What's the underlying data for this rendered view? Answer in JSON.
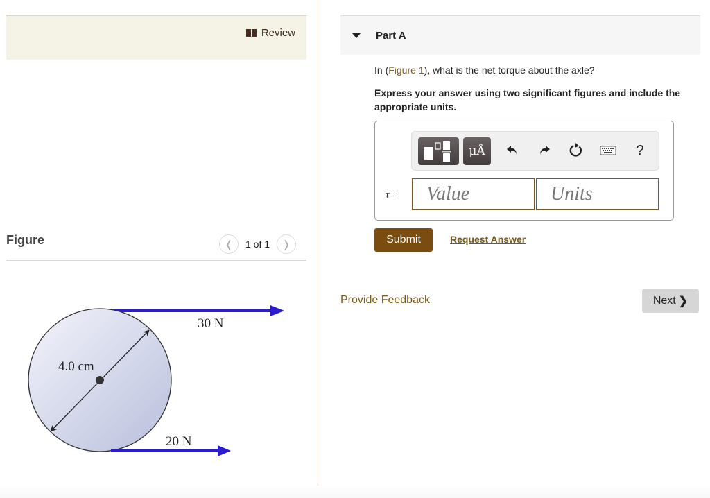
{
  "review": {
    "label": "Review",
    "icon": "book-icon"
  },
  "figure_panel": {
    "title": "Figure",
    "pager_text": "1 of 1",
    "prev_icon": "chevron-left-icon",
    "next_icon": "chevron-right-icon",
    "diagram": {
      "diameter_label": "4.0 cm",
      "top_force_label": "30 N",
      "bottom_force_label": "20 N",
      "force_color": "#2b1ccf"
    }
  },
  "part": {
    "title": "Part A",
    "question_prefix": "In (",
    "question_link": "Figure 1",
    "question_suffix": "), what is the net torque about the axle?",
    "instruction": "Express your answer using two significant figures and include the appropriate units.",
    "toolbar": {
      "template_icon": "templates-icon",
      "units_label": "μÅ",
      "undo_icon": "undo-icon",
      "redo_icon": "redo-icon",
      "reset_icon": "reset-icon",
      "keyboard_icon": "keyboard-icon",
      "help_label": "?"
    },
    "variable_label": "τ",
    "equals": "=",
    "value_placeholder": "Value",
    "units_placeholder": "Units",
    "value": "",
    "units": "",
    "submit_label": "Submit",
    "request_answer_label": "Request Answer"
  },
  "footer": {
    "feedback_label": "Provide Feedback",
    "next_label": "Next"
  },
  "colors": {
    "accent_brown": "#7a4c0f",
    "link_brown": "#7a5a14",
    "review_bg": "#f5f3e5"
  }
}
